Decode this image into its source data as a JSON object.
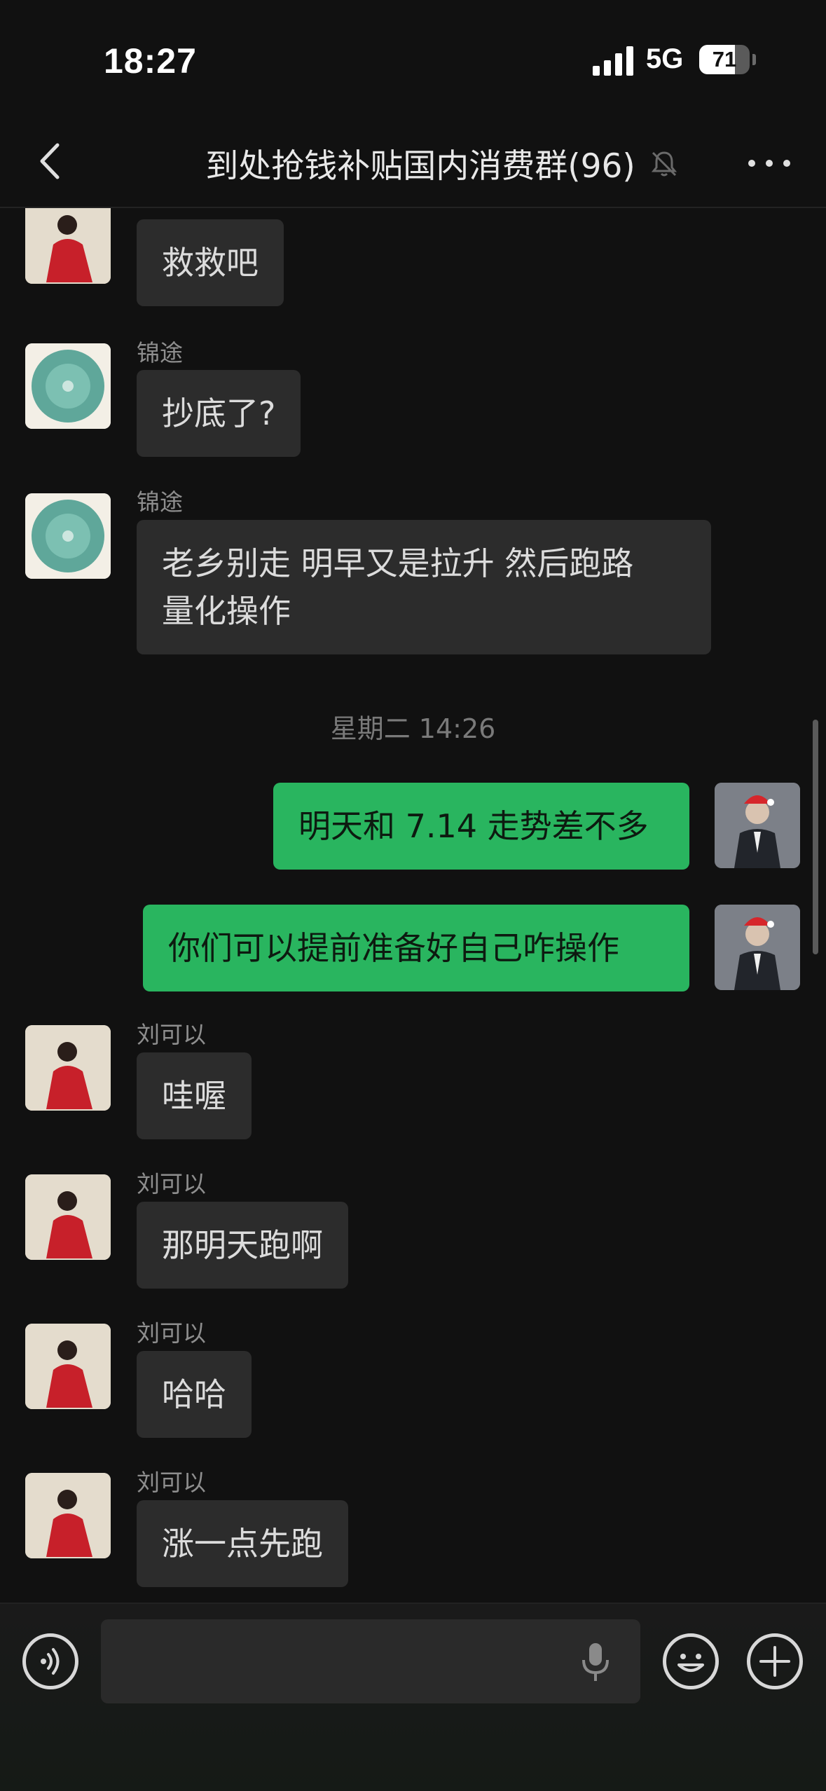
{
  "status_bar": {
    "time": "18:27",
    "network": "5G",
    "battery": "71",
    "battery_level": 0.71
  },
  "header": {
    "title": "到处抢钱补贴国内消费群(96)"
  },
  "messages": [
    {
      "sender": "",
      "text": "救救吧",
      "direction": "in"
    },
    {
      "sender": "锦途",
      "text": "抄底了?",
      "direction": "in"
    },
    {
      "sender": "锦途",
      "line1": "老乡别走  明早又是拉升 然后跑路",
      "line2": "量化操作",
      "direction": "in"
    },
    {
      "time_divider": "星期二 14:26"
    },
    {
      "text": "明天和 7.14 走势差不多",
      "direction": "out"
    },
    {
      "text": "你们可以提前准备好自己咋操作",
      "direction": "out"
    },
    {
      "sender": "刘可以",
      "text": "哇喔",
      "direction": "in"
    },
    {
      "sender": "刘可以",
      "text": "那明天跑啊",
      "direction": "in"
    },
    {
      "sender": "刘可以",
      "text": "哈哈",
      "direction": "in"
    },
    {
      "sender": "刘可以",
      "text": "涨一点先跑",
      "direction": "in"
    }
  ],
  "input": {
    "placeholder": ""
  },
  "icons": [
    "back-icon",
    "mute-icon",
    "more-icon",
    "voice-icon",
    "mic-icon",
    "emoji-icon",
    "add-icon"
  ],
  "colors": {
    "background": "#111111",
    "outgoing_bubble": "#29b55f",
    "incoming_bubble": "#2c2c2c"
  }
}
